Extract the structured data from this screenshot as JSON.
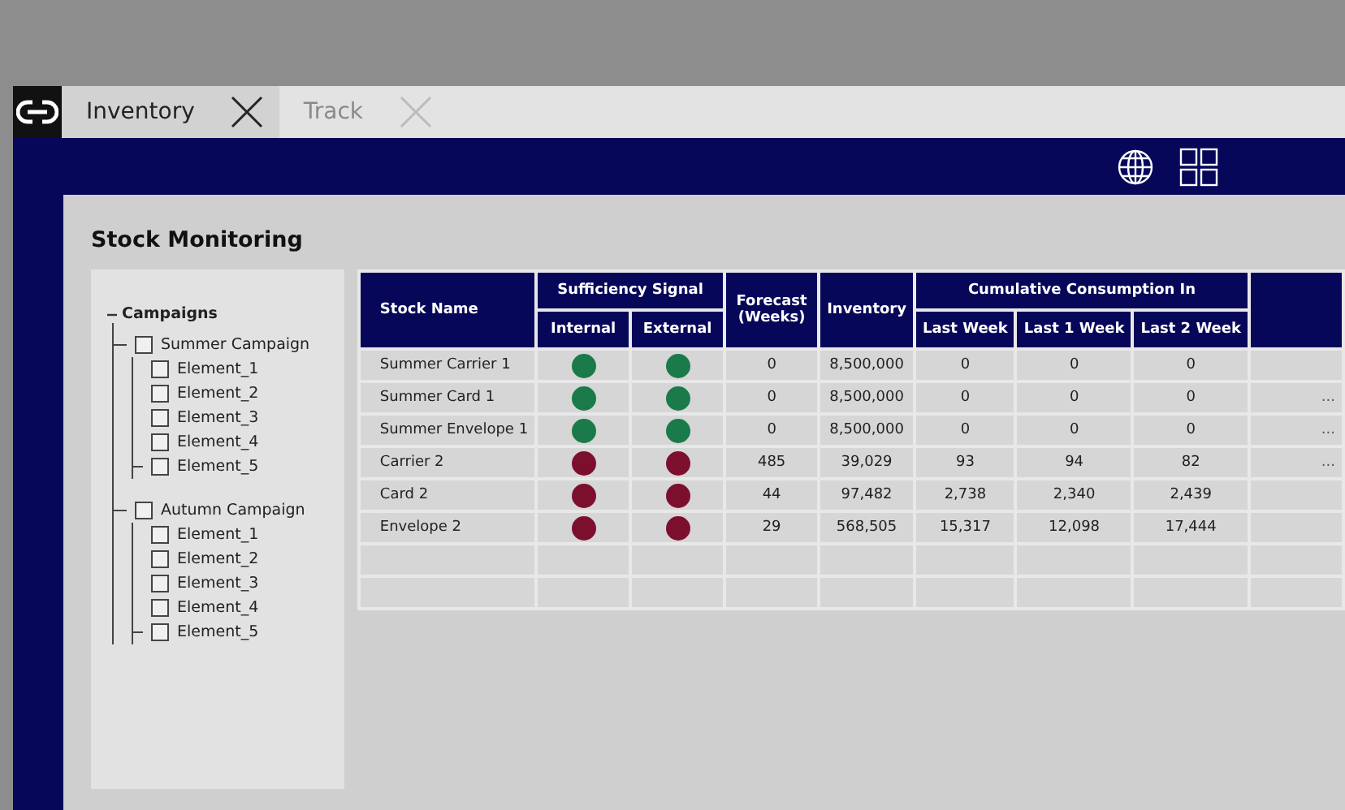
{
  "tabs": [
    {
      "label": "Inventory",
      "selected": true
    },
    {
      "label": "Track",
      "selected": false
    }
  ],
  "page_title": "Stock Monitoring",
  "tree": {
    "label": "Campaigns",
    "expanded": true,
    "children": [
      {
        "label": "Summer Campaign",
        "checked": false,
        "children": [
          {
            "label": "Element_1",
            "checked": false
          },
          {
            "label": "Element_2",
            "checked": false
          },
          {
            "label": "Element_3",
            "checked": false
          },
          {
            "label": "Element_4",
            "checked": false
          },
          {
            "label": "Element_5",
            "checked": false
          }
        ]
      },
      {
        "label": "Autumn Campaign",
        "checked": false,
        "children": [
          {
            "label": "Element_1",
            "checked": false
          },
          {
            "label": "Element_2",
            "checked": false
          },
          {
            "label": "Element_3",
            "checked": false
          },
          {
            "label": "Element_4",
            "checked": false
          },
          {
            "label": "Element_5",
            "checked": false
          }
        ]
      }
    ]
  },
  "table": {
    "headers": {
      "stock_name": "Stock Name",
      "signal_group": "Sufficiency Signal",
      "internal": "Internal",
      "external": "External",
      "forecast": "Forecast (Weeks)",
      "inventory": "Inventory",
      "consumption_group": "Cumulative Consumption In",
      "last_week": "Last Week",
      "last_1_week": "Last 1 Week",
      "last_2_week": "Last 2 Week"
    },
    "rows": [
      {
        "name": "Summer Carrier 1",
        "internal": {
          "color": "#1a7a4a"
        },
        "external": {
          "color": "#1a7a4a"
        },
        "forecast": "0",
        "inventory": "8,500,000",
        "last_week": "0",
        "last_1_week": "0",
        "last_2_week": "0"
      },
      {
        "name": "Summer Card 1",
        "internal": {
          "color": "#1a7a4a"
        },
        "external": {
          "color": "#1a7a4a"
        },
        "forecast": "0",
        "inventory": "8,500,000",
        "last_week": "0",
        "last_1_week": "0",
        "last_2_week": "0",
        "column_9": "..."
      },
      {
        "name": "Summer Envelope 1",
        "internal": {
          "color": "#1a7a4a"
        },
        "external": {
          "color": "#1a7a4a"
        },
        "forecast": "0",
        "inventory": "8,500,000",
        "last_week": "0",
        "last_1_week": "0",
        "last_2_week": "0",
        "column_9": "..."
      },
      {
        "name": "Carrier 2",
        "internal": {
          "color": "#7d0f2e"
        },
        "external": {
          "color": "#7d0f2e"
        },
        "forecast": "485",
        "inventory": "39,029",
        "last_week": "93",
        "last_1_week": "94",
        "last_2_week": "82",
        "column_9": "..."
      },
      {
        "name": "Card 2",
        "internal": {
          "color": "#7d0f2e"
        },
        "external": {
          "color": "#7d0f2e"
        },
        "forecast": "44",
        "inventory": "97,482",
        "last_week": "2,738",
        "last_1_week": "2,340",
        "last_2_week": "2,439"
      },
      {
        "name": "Envelope 2",
        "internal": {
          "color": "#7d0f2e"
        },
        "external": {
          "color": "#7d0f2e"
        },
        "forecast": "29",
        "inventory": "568,505",
        "last_week": "15,317",
        "last_1_week": "12,098",
        "last_2_week": "17,444"
      }
    ]
  }
}
